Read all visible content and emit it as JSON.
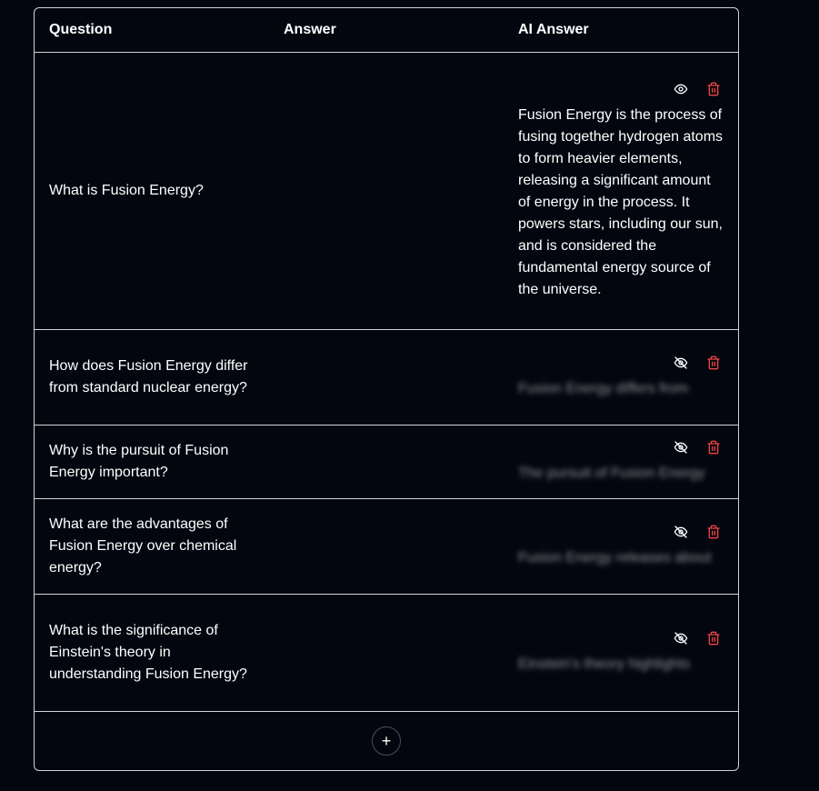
{
  "table": {
    "headers": {
      "question": "Question",
      "answer": "Answer",
      "ai_answer": "AI Answer"
    },
    "rows": [
      {
        "question": "What is Fusion Energy?",
        "answer": "",
        "ai_answer": "Fusion Energy is the process of fusing together hydrogen atoms to form heavier elements, releasing a significant amount of energy in the process. It powers stars, including our sun, and is considered the fundamental energy source of the universe.",
        "visible": true,
        "toggle_icon": "eye-icon",
        "delete_icon": "trash-icon"
      },
      {
        "question": "How does Fusion Energy differ from standard nuclear energy?",
        "answer": "",
        "ai_answer": "Fusion Energy differs from",
        "visible": false,
        "toggle_icon": "eye-off-icon",
        "delete_icon": "trash-icon"
      },
      {
        "question": "Why is the pursuit of Fusion Energy important?",
        "answer": "",
        "ai_answer": "The pursuit of Fusion Energy",
        "visible": false,
        "toggle_icon": "eye-off-icon",
        "delete_icon": "trash-icon"
      },
      {
        "question": "What are the advantages of Fusion Energy over chemical energy?",
        "answer": "",
        "ai_answer": "Fusion Energy releases about",
        "visible": false,
        "toggle_icon": "eye-off-icon",
        "delete_icon": "trash-icon"
      },
      {
        "question": "What is the significance of Einstein's theory in understanding Fusion Energy?",
        "answer": "",
        "ai_answer": "Einstein's theory highlights",
        "visible": false,
        "toggle_icon": "eye-off-icon",
        "delete_icon": "trash-icon"
      }
    ],
    "add_button": {
      "symbol": "+",
      "icon": "plus-icon"
    }
  },
  "colors": {
    "background": "#03060f",
    "border": "#cfd3da",
    "text": "#ffffff",
    "delete": "#ef4444",
    "icon": "#ffffff"
  }
}
